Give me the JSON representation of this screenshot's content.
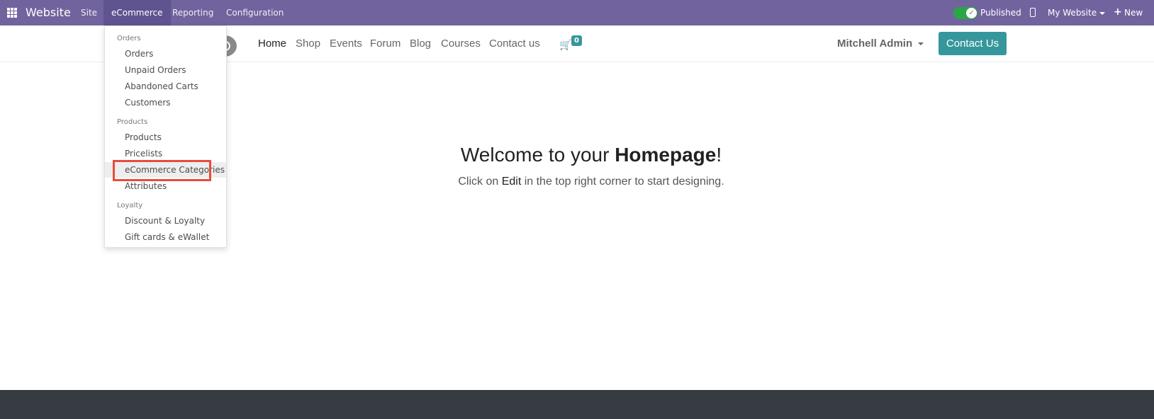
{
  "topbar": {
    "brand": "Website",
    "menu": [
      "Site",
      "eCommerce",
      "Reporting",
      "Configuration"
    ],
    "published_label": "Published",
    "website_switcher": "My Website",
    "new_label": "New"
  },
  "header": {
    "nav": [
      "Home",
      "Shop",
      "Events",
      "Forum",
      "Blog",
      "Courses",
      "Contact us"
    ],
    "cart_count": "0",
    "user": "Mitchell Admin",
    "contact_button": "Contact Us"
  },
  "main": {
    "title_pre": "Welcome to your ",
    "title_bold": "Homepage",
    "title_post": "!",
    "sub_pre": "Click on ",
    "sub_bold": "Edit",
    "sub_post": " in the top right corner to start designing."
  },
  "dropdown": {
    "sections": [
      {
        "header": "Orders",
        "items": [
          "Orders",
          "Unpaid Orders",
          "Abandoned Carts",
          "Customers"
        ]
      },
      {
        "header": "Products",
        "items": [
          "Products",
          "Pricelists",
          "eCommerce Categories",
          "Attributes"
        ]
      },
      {
        "header": "Loyalty",
        "items": [
          "Discount & Loyalty",
          "Gift cards & eWallet"
        ]
      }
    ]
  },
  "colors": {
    "topbar": "#71639e",
    "accent": "#35979c",
    "highlight": "#e74c3c",
    "footer": "#373c43"
  }
}
